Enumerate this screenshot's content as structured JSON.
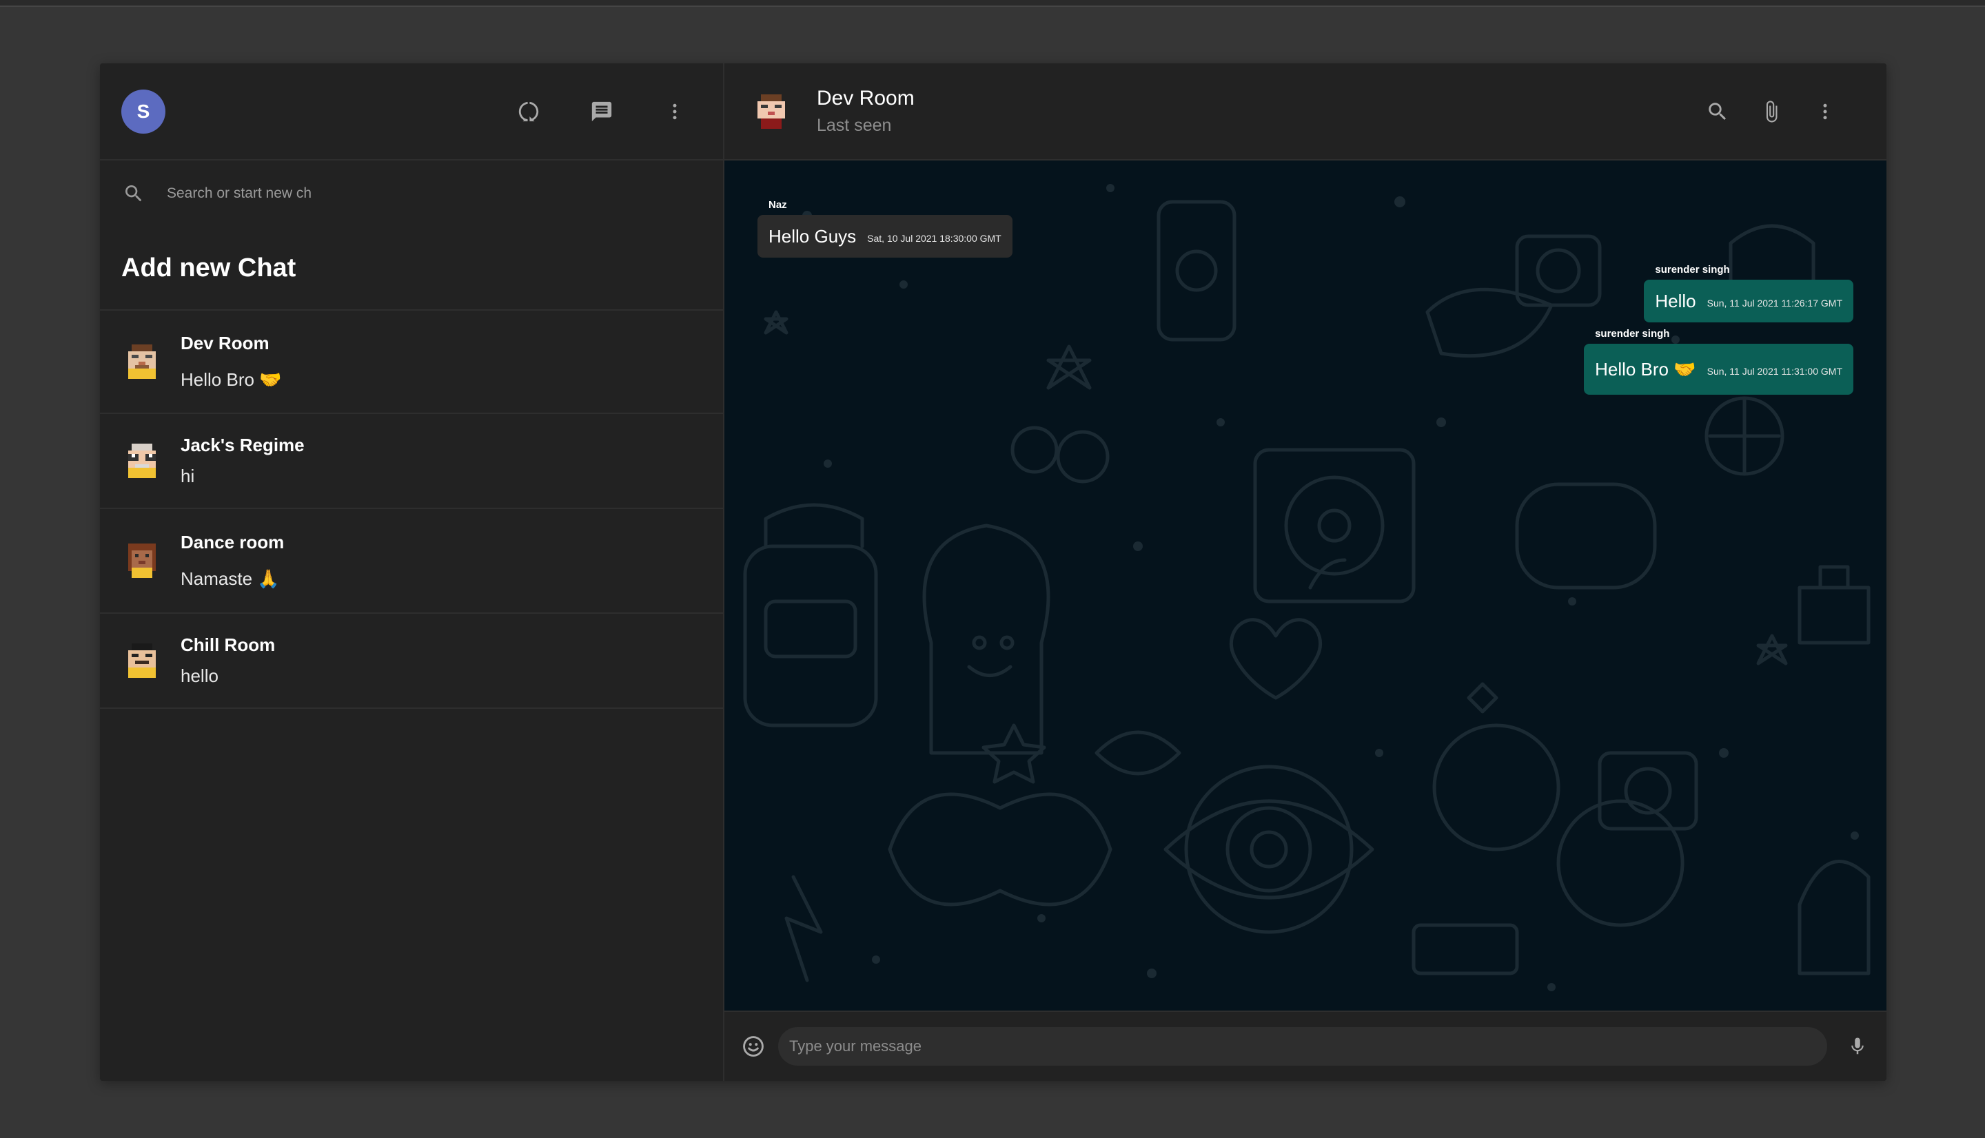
{
  "sidebar": {
    "user_initial": "S",
    "search_placeholder": "Search or start new chat",
    "add_new_chat": "Add new Chat",
    "chats": [
      {
        "name": "Dev Room",
        "last_message": "Hello Bro 🤝"
      },
      {
        "name": "Jack's Regime",
        "last_message": "hi"
      },
      {
        "name": "Dance room",
        "last_message": "Namaste 🙏"
      },
      {
        "name": "Chill Room",
        "last_message": "hello"
      }
    ]
  },
  "chat": {
    "room_name": "Dev Room",
    "status": "Last seen",
    "messages": [
      {
        "sender": "Naz",
        "text": "Hello Guys",
        "time": "Sat, 10 Jul 2021 18:30:00 GMT",
        "direction": "incoming"
      },
      {
        "sender": "surender singh",
        "text": "Hello",
        "time": "Sun, 11 Jul 2021 11:26:17 GMT",
        "direction": "outgoing"
      },
      {
        "sender": "surender singh",
        "text": "Hello Bro 🤝",
        "time": "Sun, 11 Jul 2021 11:31:00 GMT",
        "direction": "outgoing"
      }
    ],
    "input_placeholder": "Type your message"
  },
  "icons": {
    "status": "status-ring-icon",
    "new_chat": "chat-icon",
    "menu": "more-vert-icon",
    "search": "search-icon",
    "attach": "paperclip-icon",
    "emoji": "emoji-icon",
    "mic": "microphone-icon"
  },
  "colors": {
    "app_bg": "#222222",
    "page_bg": "#363636",
    "chat_bg": "#05131c",
    "outgoing_bubble": "#0b5f56",
    "incoming_bubble": "#2b2b2b",
    "avatar": "#5c6bc0"
  }
}
